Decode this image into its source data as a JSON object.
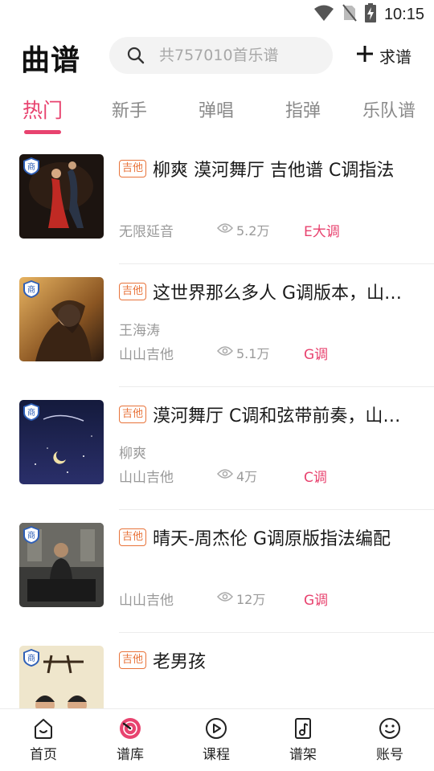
{
  "status_bar": {
    "time": "10:15",
    "icons": [
      "wifi-icon",
      "no-sim-icon",
      "battery-charging-icon"
    ]
  },
  "header": {
    "title": "曲谱",
    "search_placeholder": "共757010首乐谱",
    "request_label": "求谱",
    "request_icon": "plus-icon"
  },
  "tabs": [
    {
      "label": "热门",
      "active": true
    },
    {
      "label": "新手"
    },
    {
      "label": "弹唱"
    },
    {
      "label": "指弹"
    },
    {
      "label": "乐队谱"
    }
  ],
  "colors": {
    "accent": "#e8436f",
    "tag": "#e8733a",
    "muted": "#9a9a9a"
  },
  "items": [
    {
      "tag": "吉他",
      "badge": "商",
      "title": "柳爽 漠河舞厅 吉他谱 C调指法",
      "artist": "",
      "uploader": "无限延音",
      "views": "5.2万",
      "key": "E大调"
    },
    {
      "tag": "吉他",
      "badge": "商",
      "title": "这世界那么多人 G调版本，山…",
      "artist": "王海涛",
      "uploader": "山山吉他",
      "views": "5.1万",
      "key": "G调"
    },
    {
      "tag": "吉他",
      "badge": "商",
      "title": "漠河舞厅 C调和弦带前奏，山…",
      "artist": "柳爽",
      "uploader": "山山吉他",
      "views": "4万",
      "key": "C调"
    },
    {
      "tag": "吉他",
      "badge": "商",
      "title": "晴天-周杰伦 G调原版指法编配",
      "artist": "",
      "uploader": "山山吉他",
      "views": "12万",
      "key": "G调"
    },
    {
      "tag": "吉他",
      "badge": "商",
      "title": "老男孩",
      "artist": "",
      "uploader": "",
      "views": "",
      "key": ""
    }
  ],
  "nav": [
    {
      "label": "首页",
      "icon": "home-icon"
    },
    {
      "label": "谱库",
      "icon": "record-icon",
      "active": true
    },
    {
      "label": "课程",
      "icon": "play-icon"
    },
    {
      "label": "谱架",
      "icon": "music-sheet-icon"
    },
    {
      "label": "账号",
      "icon": "smiley-icon"
    }
  ]
}
